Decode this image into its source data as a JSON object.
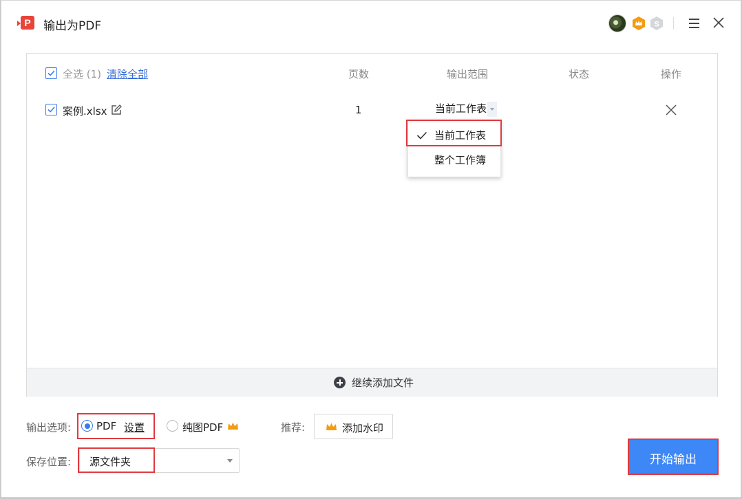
{
  "window": {
    "title": "输出为PDF",
    "logo_glyph": "P"
  },
  "header": {
    "select_all_label": "全选",
    "select_all_count": "(1)",
    "clear_all_label": "清除全部",
    "columns": {
      "pages": "页数",
      "range": "输出范围",
      "status": "状态",
      "action": "操作"
    }
  },
  "files": [
    {
      "name": "案例.xlsx",
      "pages": "1",
      "range": "当前工作表",
      "status": "",
      "checked": true
    }
  ],
  "range_dropdown": {
    "options": [
      "当前工作表",
      "整个工作簿"
    ],
    "selected_index": 0
  },
  "add_more_label": "继续添加文件",
  "output_options": {
    "label": "输出选项:",
    "pdf_label": "PDF",
    "settings_link": "设置",
    "image_pdf_label": "纯图PDF",
    "selected": "PDF"
  },
  "recommend": {
    "label": "推荐:",
    "watermark_button": "添加水印"
  },
  "save_location": {
    "label": "保存位置:",
    "value": "源文件夹"
  },
  "start_button": "开始输出",
  "colors": {
    "accent": "#3d87f7",
    "highlight": "#e0393f",
    "logo": "#e8443a",
    "crown": "#f39c12"
  },
  "icons": {
    "s_badge_letter": "S"
  }
}
